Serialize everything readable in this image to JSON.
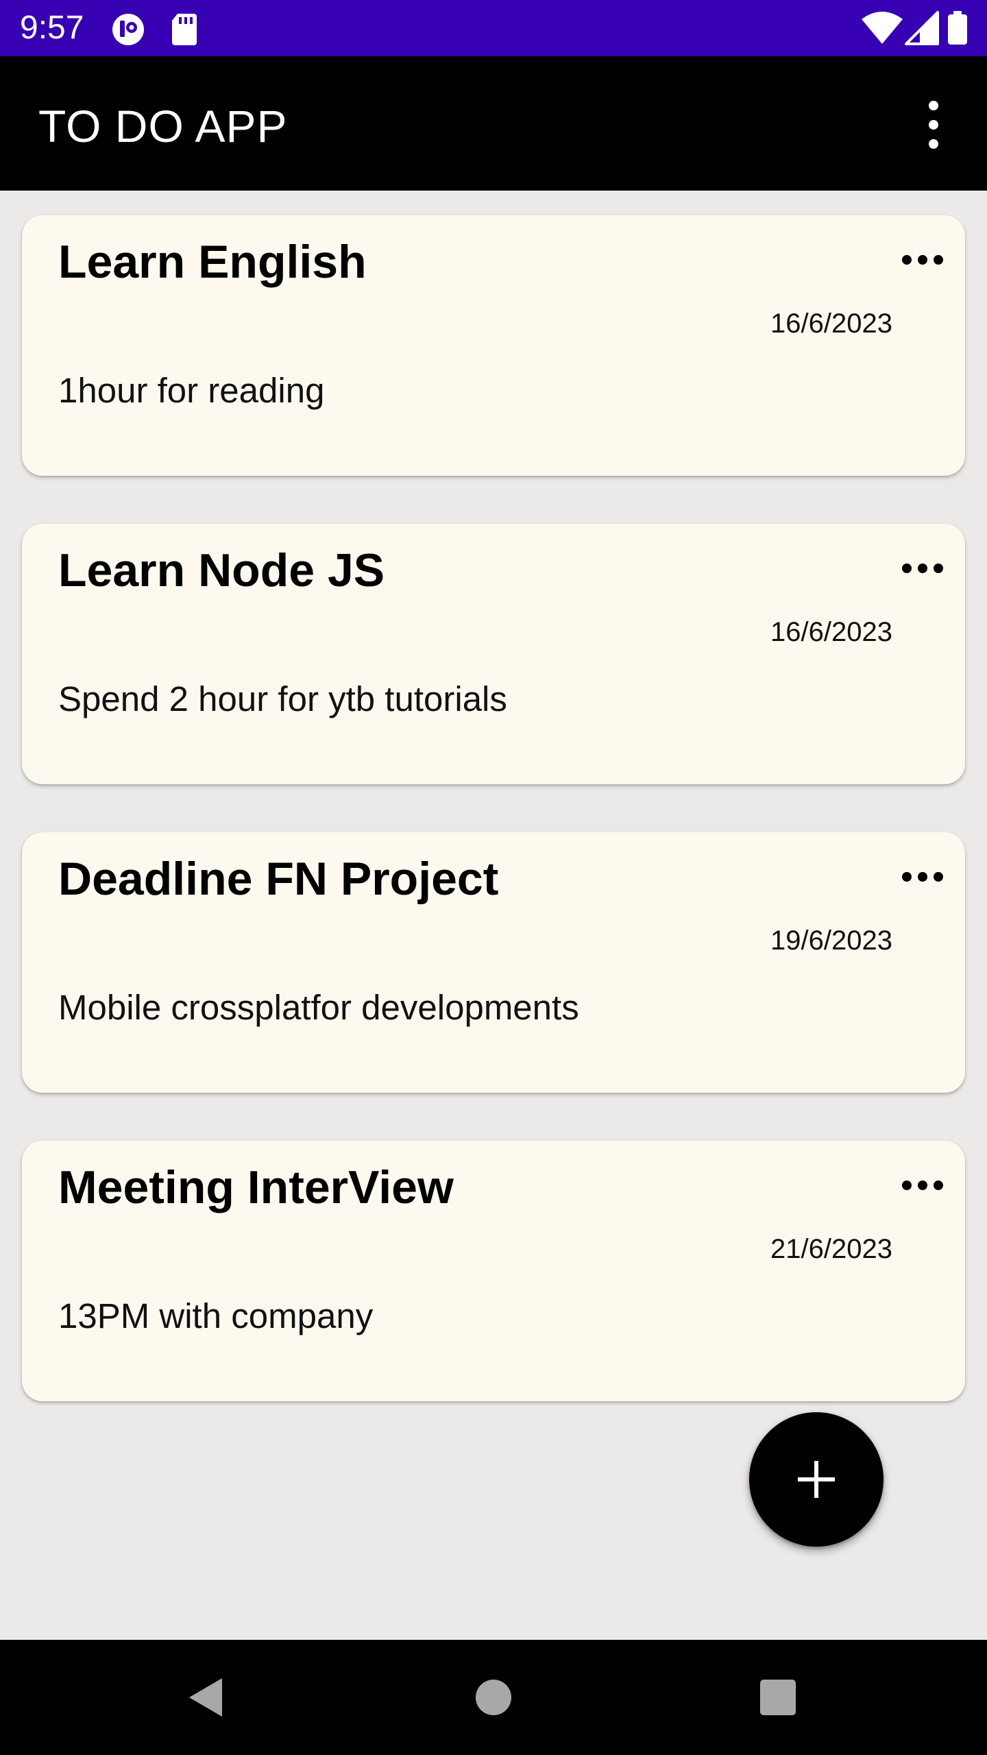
{
  "status_bar": {
    "time": "9:57",
    "icons": [
      "notification-app-icon",
      "sd-card-icon",
      "wifi-icon",
      "cellular-signal-icon",
      "battery-icon"
    ],
    "background": "#3700b3"
  },
  "app_bar": {
    "title": "TO DO APP",
    "menu_icon": "more-vertical-icon",
    "background": "#000000"
  },
  "todos": [
    {
      "title": "Learn English",
      "date": "16/6/2023",
      "description": "1hour for reading"
    },
    {
      "title": "Learn Node JS",
      "date": "16/6/2023",
      "description": "Spend 2 hour for ytb tutorials"
    },
    {
      "title": "Deadline FN Project",
      "date": "19/6/2023",
      "description": "Mobile crossplatfor developments"
    },
    {
      "title": "Meeting InterView",
      "date": "21/6/2023",
      "description": "13PM with company"
    }
  ],
  "card_menu_icon": "more-horizontal-icon",
  "card_background": "#fdf9ef",
  "fab": {
    "icon": "plus-icon",
    "background": "#000000"
  },
  "nav_bar": {
    "icons": [
      "back-icon",
      "home-icon",
      "recents-icon"
    ]
  },
  "page_background": "#ece9e9"
}
